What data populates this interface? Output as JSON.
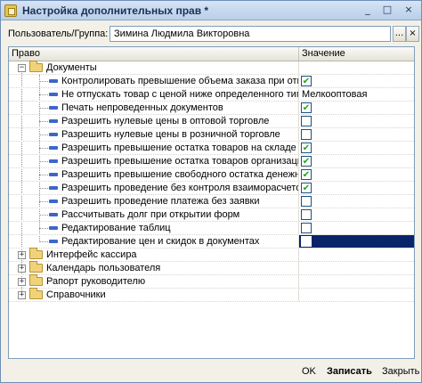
{
  "window": {
    "title": "Настройка дополнительных прав *",
    "controls": [
      "_",
      "□",
      "×"
    ]
  },
  "user": {
    "label": "Пользователь/Группа:",
    "value": "Зимина Людмила Викторовна",
    "browse_btn": "...",
    "clear_btn": "×"
  },
  "grid": {
    "columns": [
      "Право",
      "Значение"
    ],
    "rows": [
      {
        "kind": "group",
        "level": 0,
        "expanded": true,
        "label": "Документы",
        "value_type": "none"
      },
      {
        "kind": "item",
        "level": 1,
        "label": "Контролировать превышение объема заказа при отгрузке",
        "value_type": "check",
        "checked": true
      },
      {
        "kind": "item",
        "level": 1,
        "label": "Не отпускать товар с ценой ниже определенного типа",
        "value_type": "text",
        "value": "Мелкооптовая"
      },
      {
        "kind": "item",
        "level": 1,
        "label": "Печать непроведенных документов",
        "value_type": "check",
        "checked": true
      },
      {
        "kind": "item",
        "level": 1,
        "label": "Разрешить нулевые цены в оптовой торговле",
        "value_type": "check",
        "checked": false
      },
      {
        "kind": "item",
        "level": 1,
        "label": "Разрешить нулевые цены в розничной торговле",
        "value_type": "check",
        "checked": false
      },
      {
        "kind": "item",
        "level": 1,
        "label": "Разрешить превышение остатка товаров на складе",
        "value_type": "check",
        "checked": true
      },
      {
        "kind": "item",
        "level": 1,
        "label": "Разрешить превышение остатка товаров организации",
        "value_type": "check",
        "checked": true
      },
      {
        "kind": "item",
        "level": 1,
        "label": "Разрешить превышение свободного остатка денежных с...",
        "value_type": "check",
        "checked": true
      },
      {
        "kind": "item",
        "level": 1,
        "label": "Разрешить проведение без контроля взаиморасчетов",
        "value_type": "check",
        "checked": true
      },
      {
        "kind": "item",
        "level": 1,
        "label": "Разрешить проведение платежа без заявки",
        "value_type": "check",
        "checked": false
      },
      {
        "kind": "item",
        "level": 1,
        "label": "Рассчитывать долг при открытии форм",
        "value_type": "check",
        "checked": false
      },
      {
        "kind": "item",
        "level": 1,
        "label": "Редактирование таблиц",
        "value_type": "check",
        "checked": false
      },
      {
        "kind": "item",
        "level": 1,
        "label": "Редактирование цен и скидок в документах",
        "value_type": "check",
        "checked": false,
        "selected": true
      },
      {
        "kind": "group",
        "level": 0,
        "expanded": false,
        "label": "Интерфейс кассира",
        "value_type": "none"
      },
      {
        "kind": "group",
        "level": 0,
        "expanded": false,
        "label": "Календарь пользователя",
        "value_type": "none"
      },
      {
        "kind": "group",
        "level": 0,
        "expanded": false,
        "label": "Рапорт руководителю",
        "value_type": "none"
      },
      {
        "kind": "group",
        "level": 0,
        "expanded": false,
        "label": "Справочники",
        "value_type": "none"
      }
    ]
  },
  "buttons": {
    "ok": "OK",
    "save": "Записать",
    "close": "Закрыть"
  },
  "colors": {
    "selection": "#0a246a",
    "check": "#21a121",
    "item_icon": "#3d66c8"
  }
}
